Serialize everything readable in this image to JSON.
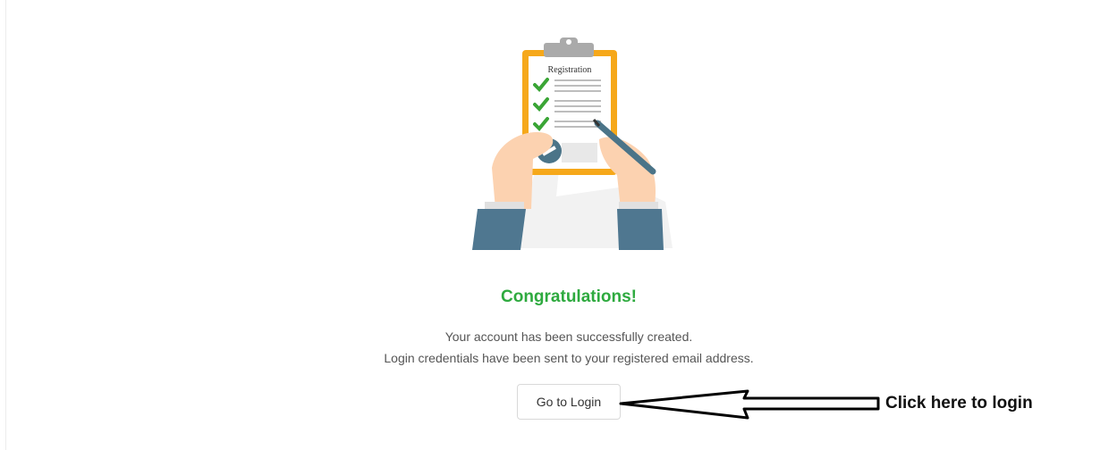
{
  "illustration": {
    "label": "Registration",
    "colors": {
      "clipboard": "#f6a81a",
      "check": "#3aa535",
      "pen": "#4b7488",
      "skin": "#fcd2b0",
      "sleeve": "#4f7790"
    }
  },
  "success": {
    "title": "Congratulations!",
    "line1": "Your account has been successfully created.",
    "line2": "Login credentials have been sent to your registered email address."
  },
  "actions": {
    "login_label": "Go to Login"
  },
  "annotation": {
    "text": "Click here to login"
  },
  "colors": {
    "success_green": "#2eaa3f",
    "text": "#555555",
    "border": "#d9d9d9"
  }
}
